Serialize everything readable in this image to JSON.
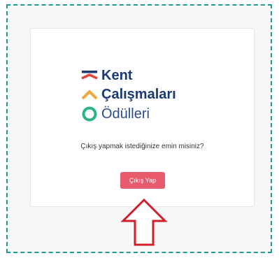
{
  "logo": {
    "line1": "Kent",
    "line2": "Çalışmaları",
    "line3": "Ödülleri"
  },
  "logout_prompt": "Çıkış yapmak istediğinize emin misiniz?",
  "logout_button": "Çıkış Yap",
  "colors": {
    "frame_border": "#1f9b8e",
    "logo_navy": "#1b3a73",
    "mark_red": "#e5433b",
    "mark_orange": "#f4a43a",
    "mark_green": "#2bb388",
    "button": "#e85a6c",
    "arrow": "#d0202a"
  },
  "icons": {
    "mark_top": "red-lines-icon",
    "mark_middle": "orange-chevron-icon",
    "mark_bottom": "green-circle-icon",
    "pointer": "red-up-arrow-icon"
  }
}
